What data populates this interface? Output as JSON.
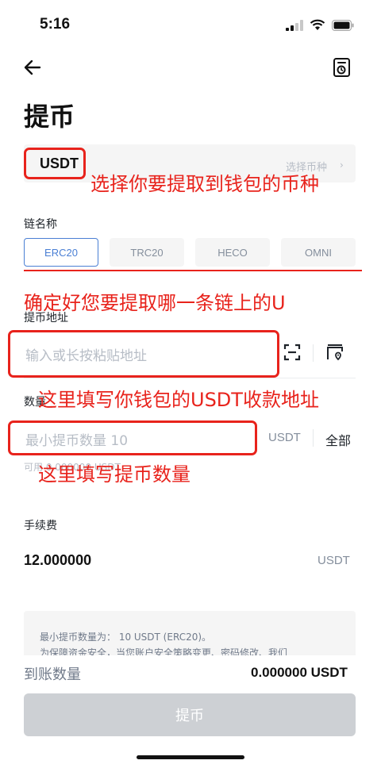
{
  "status_bar": {
    "time": "5:16"
  },
  "page": {
    "title": "提币"
  },
  "coin": {
    "value": "USDT",
    "select_hint": "选择币种",
    "chevron": "›"
  },
  "chain": {
    "label": "链名称",
    "tabs": [
      {
        "label": "ERC20",
        "active": true
      },
      {
        "label": "TRC20",
        "active": false
      },
      {
        "label": "HECO",
        "active": false
      },
      {
        "label": "OMNI",
        "active": false
      }
    ]
  },
  "address": {
    "label": "提币地址",
    "placeholder": "输入或长按粘贴地址"
  },
  "amount": {
    "label": "数量",
    "placeholder": "最小提币数量 10",
    "unit": "USDT",
    "all_label": "全部",
    "available": "可用 0.000000 USDT"
  },
  "fee": {
    "label": "手续费",
    "value": "12.000000",
    "unit": "USDT"
  },
  "notice": {
    "line1": "最小提币数量为： 10 USDT (ERC20)。",
    "line2": "为保障资金安全，当您账户安全策略变更、密码修改、我们"
  },
  "receive": {
    "label": "到账数量",
    "value": "0.000000 USDT"
  },
  "submit": {
    "label": "提币"
  },
  "annotations": {
    "coin_note": "选择你要提取到钱包的币种",
    "chain_note": "确定好您要提取哪一条链上的U",
    "address_note": "这里填写你钱包的USDT收款地址",
    "amount_note": "这里填写提币数量"
  },
  "colors": {
    "annotation": "#e8231c",
    "accent": "#4a7fd4",
    "button_disabled": "#cdd0d4"
  }
}
